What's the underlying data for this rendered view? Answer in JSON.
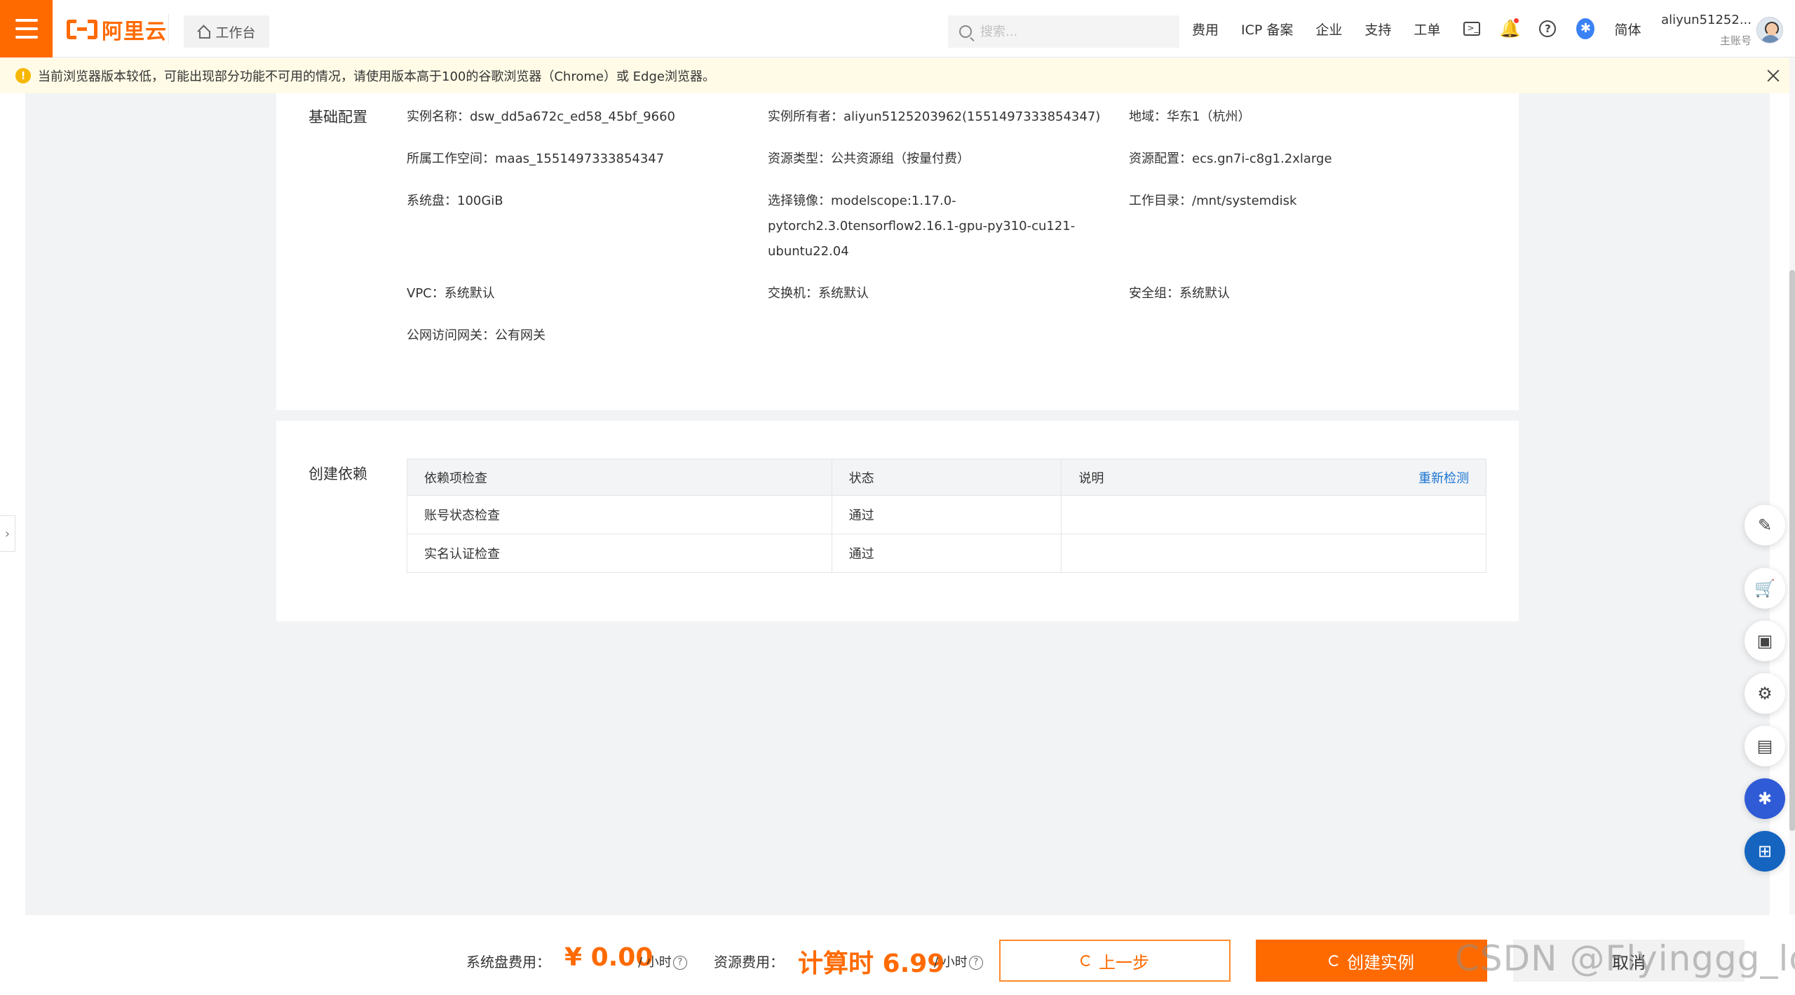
{
  "header": {
    "logo_text": "阿里云",
    "workbench_label": "工作台",
    "search_placeholder": "搜索...",
    "nav": [
      "费用",
      "ICP 备案",
      "企业",
      "支持",
      "工单"
    ],
    "lang": "简体",
    "user_name": "aliyun51252...",
    "user_role": "主账号"
  },
  "warning": {
    "text": "当前浏览器版本较低，可能出现部分功能不可用的情况，请使用版本高于100的谷歌浏览器（Chrome）或 Edge浏览器。"
  },
  "basic_config": {
    "title": "基础配置",
    "instance_name": "实例名称：dsw_dd5a672c_ed58_45bf_9660",
    "owner": "实例所有者：aliyun5125203962(1551497333854347)",
    "region": "地域：华东1（杭州）",
    "workspace": "所属工作空间：maas_1551497333854347",
    "resource_type": "资源类型：公共资源组（按量付费）",
    "resource_spec": "资源配置：ecs.gn7i-c8g1.2xlarge",
    "system_disk": "系统盘：100GiB",
    "image_line1": "选择镜像：modelscope:1.17.0-",
    "image_line2": "pytorch2.3.0tensorflow2.16.1-gpu-py310-cu121-",
    "image_line3": "ubuntu22.04",
    "workdir": "工作目录：/mnt/systemdisk",
    "vpc": "VPC：系统默认",
    "vswitch": "交换机：系统默认",
    "security_group": "安全组：系统默认",
    "gateway": "公网访问网关：公有网关"
  },
  "dependency": {
    "title": "创建依赖",
    "columns": [
      "依赖项检查",
      "状态",
      "说明"
    ],
    "recheck": "重新检测",
    "rows": [
      {
        "item": "账号状态检查",
        "status": "通过",
        "note": ""
      },
      {
        "item": "实名认证检查",
        "status": "通过",
        "note": ""
      }
    ]
  },
  "footer": {
    "disk_fee_label": "系统盘费用：",
    "disk_price": "¥ 0.00",
    "per_hour": "/ 小时",
    "resource_fee_label": "资源费用：",
    "resource_price": "计算时 6.99",
    "prev_label": "上一步",
    "create_label": "创建实例",
    "cancel_label": "取消",
    "watermark": "CSDN @Flyinggg_love"
  },
  "colors": {
    "brand": "#ff6a00",
    "link": "#1b75d0",
    "success": "#2e9d3a",
    "warning_bg": "#fffbe6"
  }
}
